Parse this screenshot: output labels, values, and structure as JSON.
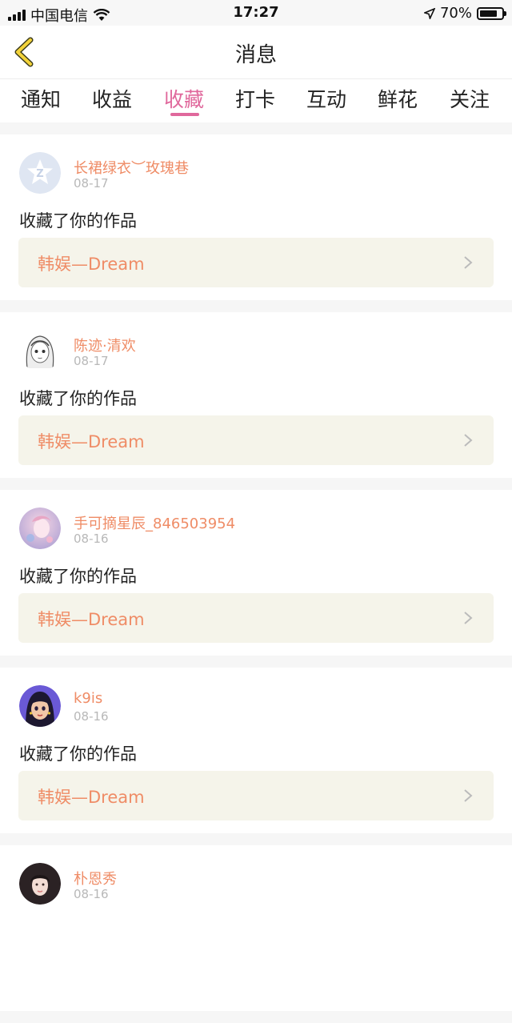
{
  "status_bar": {
    "carrier": "中国电信",
    "time": "17:27",
    "battery": "70%"
  },
  "navbar": {
    "title": "消息"
  },
  "tabs": [
    {
      "label": "通知",
      "active": false
    },
    {
      "label": "收益",
      "active": false
    },
    {
      "label": "收藏",
      "active": true
    },
    {
      "label": "打卡",
      "active": false
    },
    {
      "label": "互动",
      "active": false
    },
    {
      "label": "鲜花",
      "active": false
    },
    {
      "label": "关注",
      "active": false
    }
  ],
  "colors": {
    "accent": "#e0689c",
    "username": "#ef8c66",
    "work_bg": "#f5f4ea"
  },
  "feed": [
    {
      "username": "长裙绿衣︶玫瑰巷",
      "date": "08-17",
      "action": "收藏了你的作品",
      "work": "韩娱—Dream",
      "avatar": "default-avatar-icon"
    },
    {
      "username": "陈迹·清欢",
      "date": "08-17",
      "action": "收藏了你的作品",
      "work": "韩娱—Dream",
      "avatar": "sketch-girl-avatar"
    },
    {
      "username": "手可摘星辰_846503954",
      "date": "08-16",
      "action": "收藏了你的作品",
      "work": "韩娱—Dream",
      "avatar": "pink-anime-avatar"
    },
    {
      "username": "k9is",
      "date": "08-16",
      "action": "收藏了你的作品",
      "work": "韩娱—Dream",
      "avatar": "purple-cartoon-avatar"
    },
    {
      "username": "朴恩秀",
      "date": "08-16",
      "action": "",
      "work": "",
      "avatar": "photo-avatar"
    }
  ]
}
